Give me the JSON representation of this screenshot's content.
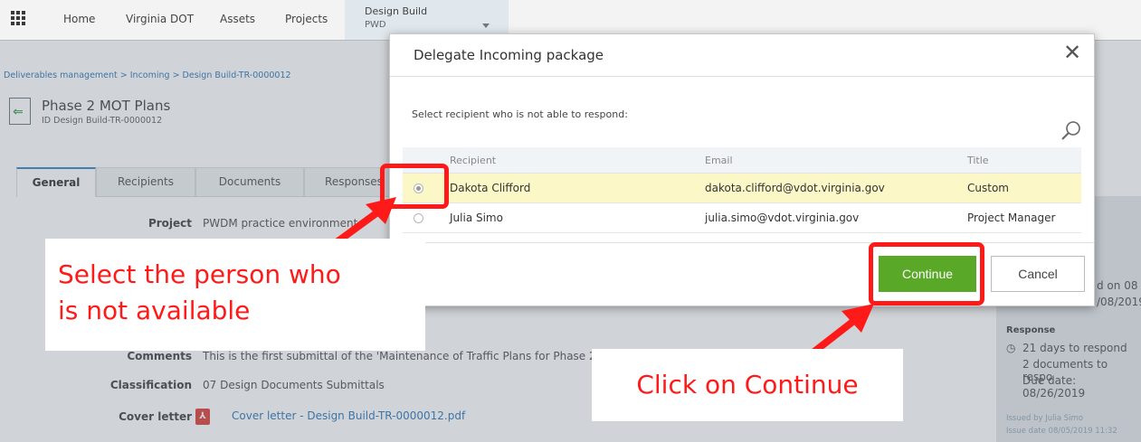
{
  "topnav": {
    "items": [
      "Home",
      "Virginia DOT",
      "Assets",
      "Projects"
    ],
    "active_line1": "Design Build",
    "active_line2": "PWD"
  },
  "page": {
    "breadcrumb": "Deliverables management > Incoming > Design Build-TR-0000012",
    "title": "Phase 2 MOT Plans",
    "id_line": "ID Design Build-TR-0000012",
    "tabs": [
      "General",
      "Recipients",
      "Documents",
      "Responses"
    ],
    "project_label": "Project",
    "project_value": "PWDM practice environment",
    "comments_label": "Comments",
    "comments_value": "This is the first submittal of the 'Maintenance of Traffic Plans for Phase 2",
    "classification_label": "Classification",
    "classification_value": "07 Design Documents Submittals",
    "cover_label": "Cover letter",
    "cover_value": "Cover letter - Design Build-TR-0000012.pdf",
    "pdf_icon_glyph": "⅄"
  },
  "right_panel": {
    "partial_1": "d on 08",
    "partial_2": "/08/2019",
    "response_heading": "Response",
    "days": "21 days to respond",
    "docs": "2 documents to respo",
    "due": "Due date: 08/26/2019",
    "issued_by": "Issued by Julia Simo",
    "issue_date": "Issue date 08/05/2019 11:32"
  },
  "modal": {
    "title": "Delegate Incoming package",
    "close_glyph": "✕",
    "instruction": "Select recipient who is not able to respond:",
    "columns": [
      "Recipient",
      "Email",
      "Title"
    ],
    "rows": [
      {
        "recipient": "Dakota Clifford",
        "email": "dakota.clifford@vdot.virginia.gov",
        "title": "Custom",
        "selected": true
      },
      {
        "recipient": "Julia Simo",
        "email": "julia.simo@vdot.virginia.gov",
        "title": "Project Manager",
        "selected": false
      }
    ],
    "continue_label": "Continue",
    "cancel_label": "Cancel"
  },
  "annotations": {
    "select_line1": "Select the person who",
    "select_line2": "is not available",
    "continue_callout": "Click on Continue"
  },
  "colors": {
    "annotation": "#ff1a1a",
    "continue_button": "#5aa827",
    "selected_row": "#fbf7c6",
    "link": "#1f6fb2"
  }
}
